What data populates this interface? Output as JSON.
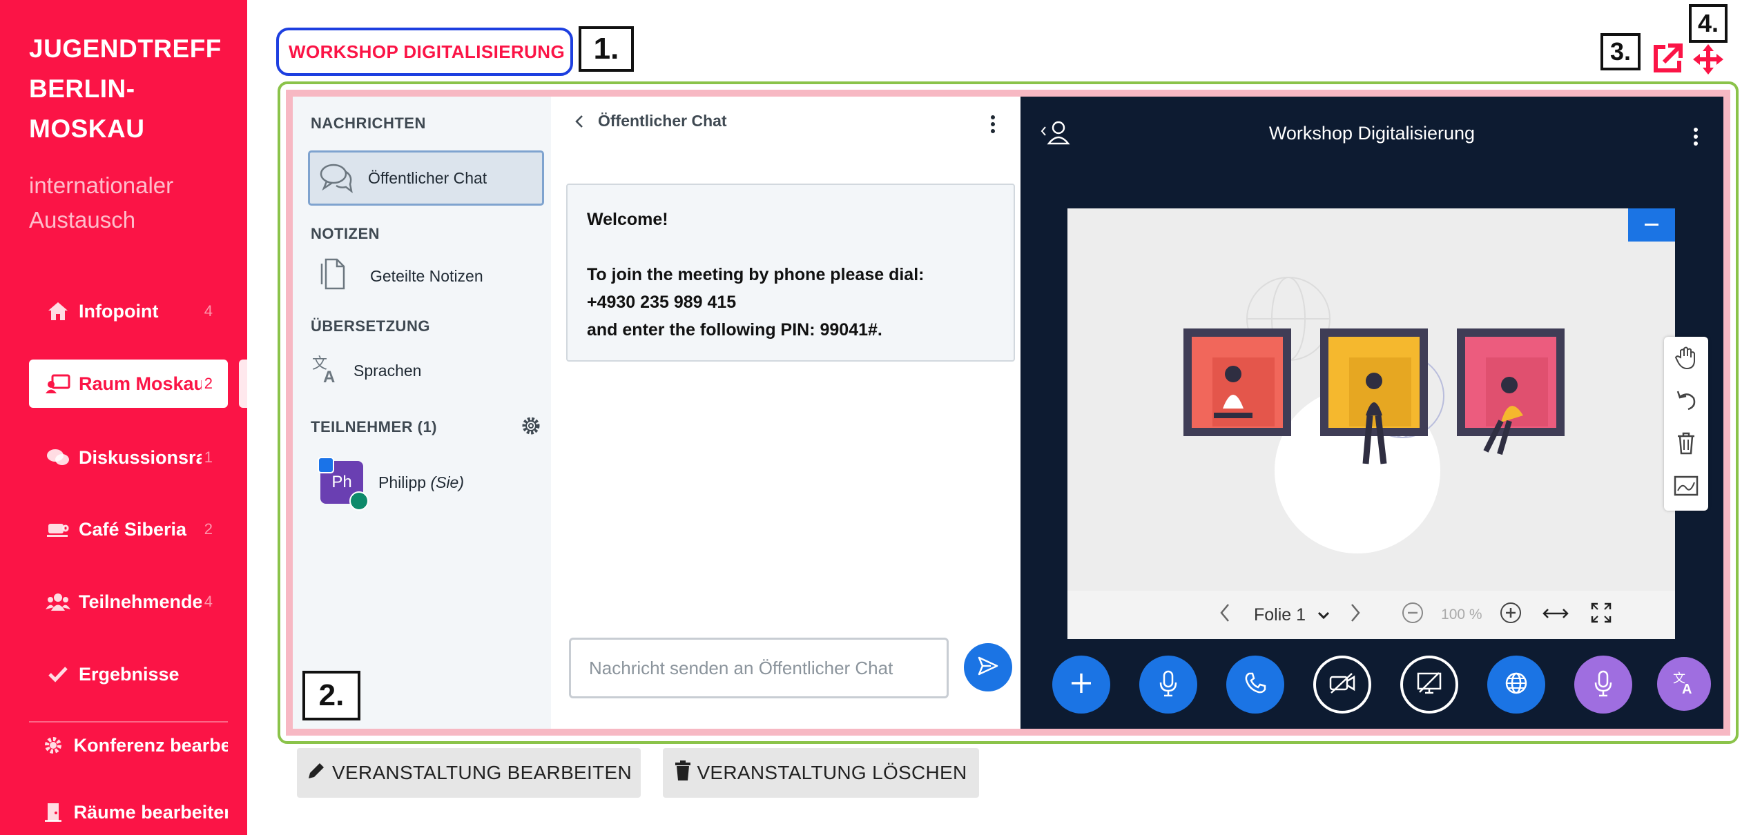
{
  "sidebar": {
    "brand_line1": "JUGENDTREFF",
    "brand_line2": "BERLIN-",
    "brand_line3": "MOSKAU",
    "subtitle_line1": "internationaler",
    "subtitle_line2": "Austausch",
    "items": [
      {
        "label": "Infopoint",
        "count": "4",
        "icon": "home-icon"
      },
      {
        "label": "Raum Moskau",
        "count": "2",
        "icon": "presenter-icon"
      },
      {
        "label": "Diskussionsraum",
        "count": "1",
        "icon": "chat-bubbles-icon"
      },
      {
        "label": "Café Siberia",
        "count": "2",
        "icon": "coffee-cup-icon"
      },
      {
        "label": "Teilnehmende",
        "count": "4",
        "icon": "users-icon"
      },
      {
        "label": "Ergebnisse",
        "count": "",
        "icon": "check-icon"
      }
    ],
    "admin_items": [
      {
        "label": "Konferenz bearbeiten",
        "icon": "gear-icon"
      },
      {
        "label": "Räume bearbeiten",
        "icon": "door-icon"
      }
    ],
    "colors": {
      "brand": "#fb1446",
      "text": "#ffffff"
    }
  },
  "header": {
    "event_title": "WORKSHOP DIGITALISIERUNG",
    "markers": [
      "1.",
      "2.",
      "3.",
      "4."
    ]
  },
  "bbb": {
    "left_panel": {
      "messages_title": "NACHRICHTEN",
      "public_chat": "Öffentlicher Chat",
      "notes_title": "NOTIZEN",
      "shared_notes": "Geteilte Notizen",
      "translation_title": "ÜBERSETZUNG",
      "languages": "Sprachen",
      "participants_title": "TEILNEHMER (1)",
      "participant_initials": "Ph",
      "participant_name": "Philipp",
      "participant_you": "(Sie)"
    },
    "chat": {
      "header": "Öffentlicher Chat",
      "welcome_title": "Welcome!",
      "welcome_line1": "To join the meeting by phone please dial:",
      "welcome_line2": "+4930 235 989 415",
      "welcome_line3": "and enter the following PIN: 99041#.",
      "input_placeholder": "Nachricht senden an Öffentlicher Chat"
    },
    "presentation": {
      "title": "Workshop Digitalisierung",
      "slide_label": "Folie 1",
      "zoom": "100 %",
      "colors": {
        "background": "#0d1b31",
        "accent": "#1b74e4",
        "purple": "#9f6ee0"
      }
    }
  },
  "actions": {
    "edit_event": "VERANSTALTUNG BEARBEITEN",
    "delete_event": "VERANSTALTUNG LÖSCHEN"
  }
}
